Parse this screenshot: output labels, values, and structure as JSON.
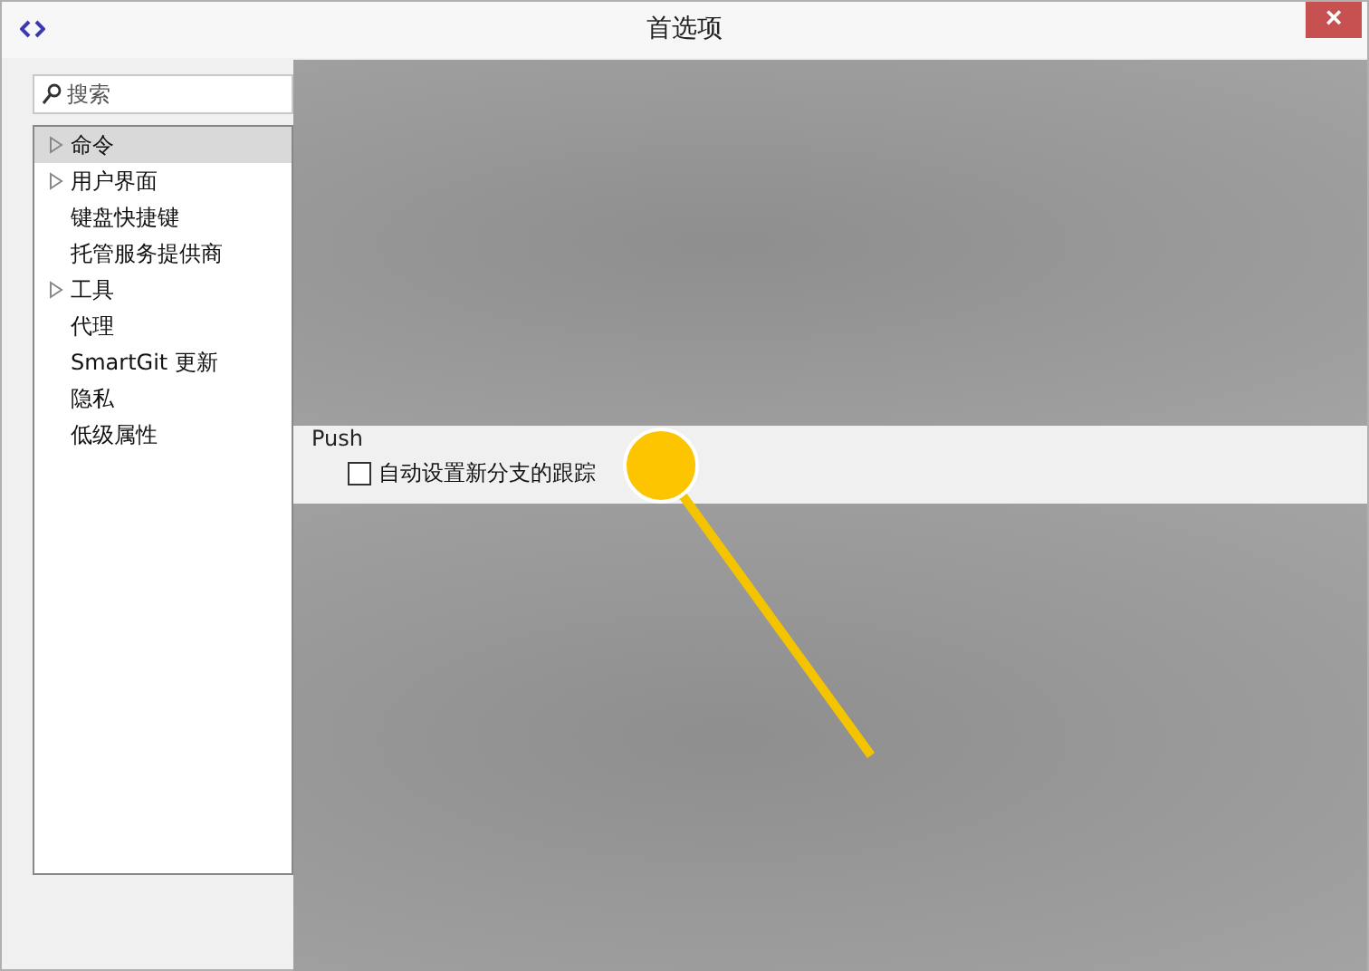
{
  "window": {
    "title": "首选项",
    "close": "×"
  },
  "sidebar": {
    "search": {
      "placeholder": "搜索"
    },
    "items": [
      {
        "label": "命令",
        "expandable": true,
        "selected": true
      },
      {
        "label": "用户界面",
        "expandable": true,
        "selected": false
      },
      {
        "label": "键盘快捷键",
        "expandable": false,
        "selected": false
      },
      {
        "label": "托管服务提供商",
        "expandable": false,
        "selected": false
      },
      {
        "label": "工具",
        "expandable": true,
        "selected": false
      },
      {
        "label": "代理",
        "expandable": false,
        "selected": false
      },
      {
        "label": "SmartGit 更新",
        "expandable": false,
        "selected": false
      },
      {
        "label": "隐私",
        "expandable": false,
        "selected": false
      },
      {
        "label": "低级属性",
        "expandable": false,
        "selected": false
      }
    ]
  },
  "content": {
    "section": "Push",
    "options": [
      {
        "label": "自动设置新分支的跟踪",
        "checked": false
      }
    ]
  }
}
